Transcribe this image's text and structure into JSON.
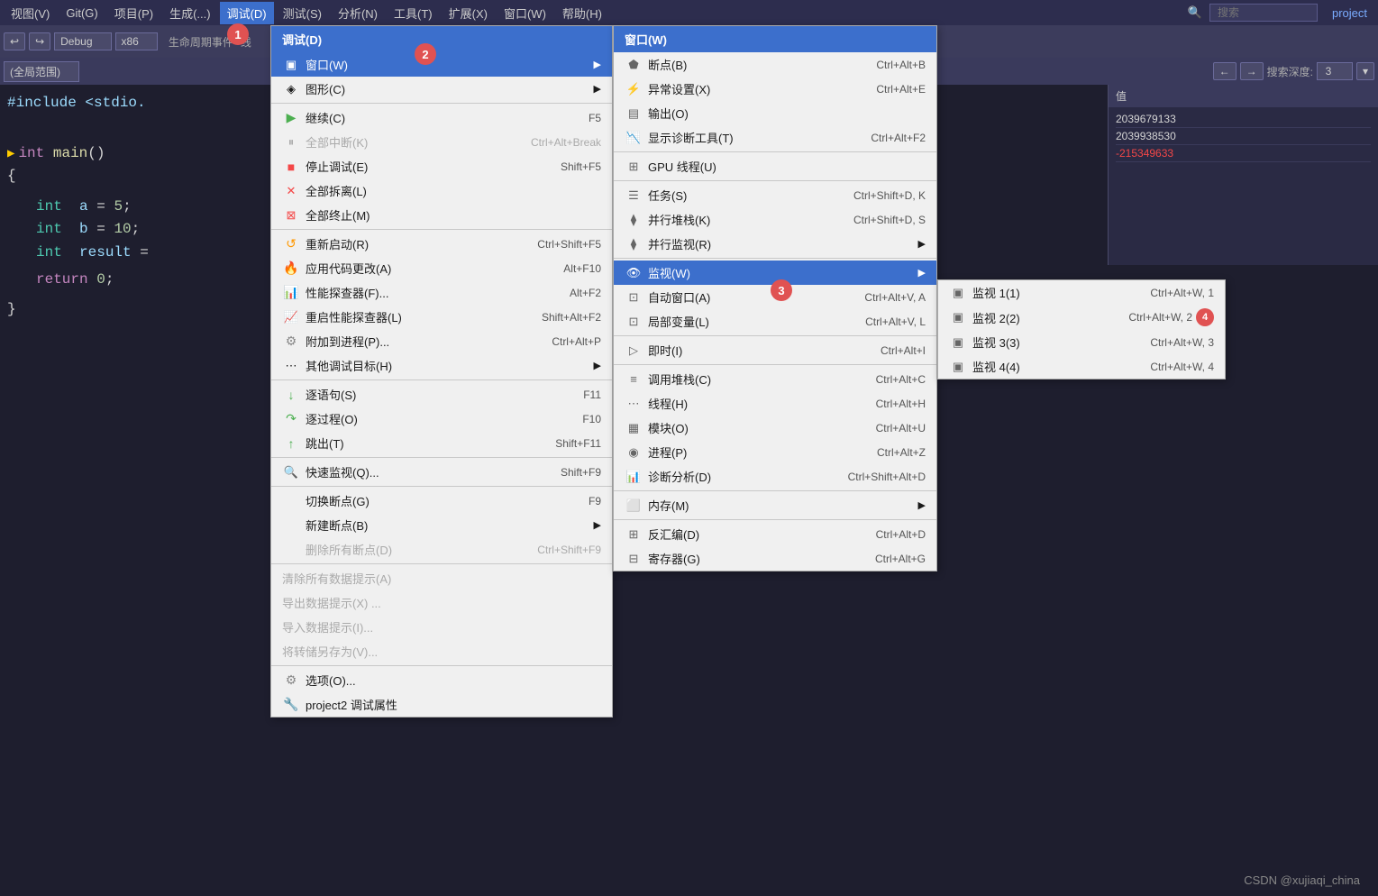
{
  "menubar": {
    "items": [
      {
        "label": "视图(V)",
        "active": false
      },
      {
        "label": "Git(G)",
        "active": false
      },
      {
        "label": "项目(P)",
        "active": false
      },
      {
        "label": "生成(...)",
        "active": false
      },
      {
        "label": "调试(D)",
        "active": true
      },
      {
        "label": "测试(S)",
        "active": false
      },
      {
        "label": "分析(N)",
        "active": false
      },
      {
        "label": "工具(T)",
        "active": false
      },
      {
        "label": "扩展(X)",
        "active": false
      },
      {
        "label": "窗口(W)",
        "active": false
      },
      {
        "label": "帮助(H)",
        "active": false
      }
    ],
    "search_placeholder": "搜索",
    "project_label": "project"
  },
  "toolbar": {
    "debug_config": "Debug",
    "platform": "x86",
    "lifecycle_label": "生命周期事件",
    "thread_label": "线"
  },
  "toolbar2": {
    "scope_label": "(全局范围)",
    "search_depth_label": "搜索深度:",
    "search_depth_value": "3"
  },
  "code": {
    "include_line": "#include <stdio.",
    "lines": [
      {
        "indent": 0,
        "text": "int main()",
        "has_indicator": true
      },
      {
        "indent": 0,
        "text": "{"
      },
      {
        "indent": 1,
        "text": "int  a = 5;"
      },
      {
        "indent": 1,
        "text": "int  b = 10;"
      },
      {
        "indent": 1,
        "text": "int  result "
      },
      {
        "indent": 1,
        "text": "return 0;"
      },
      {
        "indent": 0,
        "text": "}"
      }
    ]
  },
  "right_panel": {
    "header": "值",
    "nav_back": "←",
    "nav_forward": "→",
    "values": [
      {
        "text": "2039679133"
      },
      {
        "text": "2039938530"
      },
      {
        "text": "-215349633",
        "red": true
      }
    ]
  },
  "debug_menu": {
    "header": "调试(D)",
    "items": [
      {
        "label": "窗口(W)",
        "shortcut": "",
        "has_submenu": true,
        "highlighted": true,
        "icon": "window-icon"
      },
      {
        "label": "图形(C)",
        "shortcut": "",
        "has_submenu": true,
        "icon": "graphics-icon"
      },
      {
        "separator": true
      },
      {
        "label": "继续(C)",
        "shortcut": "F5",
        "icon": "play-icon"
      },
      {
        "label": "全部中断(K)",
        "shortcut": "Ctrl+Alt+Break",
        "icon": "pause-icon",
        "disabled": true
      },
      {
        "label": "停止调试(E)",
        "shortcut": "Shift+F5",
        "icon": "stop-icon"
      },
      {
        "label": "全部拆离(L)",
        "shortcut": "",
        "icon": "detach-icon"
      },
      {
        "label": "全部终止(M)",
        "shortcut": "",
        "icon": "terminate-icon"
      },
      {
        "separator": true
      },
      {
        "label": "重新启动(R)",
        "shortcut": "Ctrl+Shift+F5",
        "icon": "restart-icon"
      },
      {
        "label": "应用代码更改(A)",
        "shortcut": "Alt+F10",
        "icon": "hotreload-icon"
      },
      {
        "label": "性能探查器(F)...",
        "shortcut": "Alt+F2",
        "icon": "perf-icon"
      },
      {
        "label": "重启性能探查器(L)",
        "shortcut": "Shift+Alt+F2",
        "icon": "perf-restart-icon"
      },
      {
        "label": "附加到进程(P)...",
        "shortcut": "Ctrl+Alt+P",
        "icon": "attach-icon"
      },
      {
        "label": "其他调试目标(H)",
        "shortcut": "",
        "has_submenu": true,
        "icon": "other-icon"
      },
      {
        "separator": true
      },
      {
        "label": "逐语句(S)",
        "shortcut": "F11",
        "icon": "stepinto-icon"
      },
      {
        "label": "逐过程(O)",
        "shortcut": "F10",
        "icon": "stepover-icon"
      },
      {
        "label": "跳出(T)",
        "shortcut": "Shift+F11",
        "icon": "stepout-icon"
      },
      {
        "separator": true
      },
      {
        "label": "快速监视(Q)...",
        "shortcut": "Shift+F9",
        "icon": "quickwatch-icon"
      },
      {
        "separator": true
      },
      {
        "label": "切换断点(G)",
        "shortcut": "F9",
        "icon": ""
      },
      {
        "label": "新建断点(B)",
        "shortcut": "",
        "has_submenu": true,
        "icon": ""
      },
      {
        "label": "删除所有断点(D)",
        "shortcut": "Ctrl+Shift+F9",
        "icon": "",
        "disabled": true
      },
      {
        "separator": true
      },
      {
        "label": "清除所有数据提示(A)",
        "shortcut": "",
        "icon": "",
        "disabled": true
      },
      {
        "label": "导出数据提示(X) ...",
        "shortcut": "",
        "icon": "",
        "disabled": true
      },
      {
        "label": "导入数据提示(I)...",
        "shortcut": "",
        "icon": "",
        "disabled": true
      },
      {
        "label": "将转储另存为(V)...",
        "shortcut": "",
        "icon": "",
        "disabled": true
      },
      {
        "separator": true
      },
      {
        "label": "选项(O)...",
        "shortcut": "",
        "icon": "options-icon"
      },
      {
        "label": "project2 调试属性",
        "shortcut": "",
        "icon": "proj-icon"
      }
    ]
  },
  "window_menu": {
    "header": "窗口(W)",
    "items": [
      {
        "label": "断点(B)",
        "shortcut": "Ctrl+Alt+B",
        "icon": "breakpoint-icon"
      },
      {
        "label": "异常设置(X)",
        "shortcut": "Ctrl+Alt+E",
        "icon": "exception-icon"
      },
      {
        "label": "输出(O)",
        "shortcut": "",
        "icon": "output-icon"
      },
      {
        "label": "显示诊断工具(T)",
        "shortcut": "Ctrl+Alt+F2",
        "icon": "diag-icon"
      },
      {
        "separator": true
      },
      {
        "label": "GPU 线程(U)",
        "shortcut": "",
        "icon": "gpu-icon"
      },
      {
        "separator": true
      },
      {
        "label": "任务(S)",
        "shortcut": "Ctrl+Shift+D, K",
        "icon": "task-icon"
      },
      {
        "label": "并行堆栈(K)",
        "shortcut": "Ctrl+Shift+D, S",
        "icon": "parallel-stack-icon"
      },
      {
        "label": "并行监视(R)",
        "shortcut": "",
        "has_submenu": true,
        "icon": "parallel-watch-icon"
      },
      {
        "separator": true
      },
      {
        "label": "监视(W)",
        "shortcut": "",
        "has_submenu": true,
        "highlighted": true,
        "icon": "watch-icon"
      },
      {
        "label": "自动窗口(A)",
        "shortcut": "Ctrl+Alt+V, A",
        "icon": "auto-icon"
      },
      {
        "label": "局部变量(L)",
        "shortcut": "Ctrl+Alt+V, L",
        "icon": "locals-icon"
      },
      {
        "separator": true
      },
      {
        "label": "即时(I)",
        "shortcut": "Ctrl+Alt+I",
        "icon": "immediate-icon"
      },
      {
        "separator": true
      },
      {
        "label": "调用堆栈(C)",
        "shortcut": "Ctrl+Alt+C",
        "icon": "callstack-icon"
      },
      {
        "label": "线程(H)",
        "shortcut": "Ctrl+Alt+H",
        "icon": "threads-icon"
      },
      {
        "label": "模块(O)",
        "shortcut": "Ctrl+Alt+U",
        "icon": "modules-icon"
      },
      {
        "label": "进程(P)",
        "shortcut": "Ctrl+Alt+Z",
        "icon": "process-icon"
      },
      {
        "label": "诊断分析(D)",
        "shortcut": "Ctrl+Shift+Alt+D",
        "icon": "diag2-icon"
      },
      {
        "separator": true
      },
      {
        "label": "内存(M)",
        "shortcut": "",
        "has_submenu": true,
        "icon": "memory-icon"
      },
      {
        "separator": true
      },
      {
        "label": "反汇编(D)",
        "shortcut": "Ctrl+Alt+D",
        "icon": "disassembly-icon"
      },
      {
        "label": "寄存器(G)",
        "shortcut": "Ctrl+Alt+G",
        "icon": "registers-icon"
      }
    ]
  },
  "watch_menu": {
    "header": "监视(W)",
    "items": [
      {
        "label": "监视 1(1)",
        "shortcut": "Ctrl+Alt+W, 1",
        "icon": "watch1-icon"
      },
      {
        "label": "监视 2(2)",
        "shortcut": "Ctrl+Alt+W, 2",
        "icon": "watch2-icon",
        "has_badge": true
      },
      {
        "label": "监视 3(3)",
        "shortcut": "Ctrl+Alt+W, 3",
        "icon": "watch3-icon"
      },
      {
        "label": "监视 4(4)",
        "shortcut": "Ctrl+Alt+W, 4",
        "icon": "watch4-icon"
      }
    ]
  },
  "badges": [
    {
      "number": "1",
      "description": "debug menu badge"
    },
    {
      "number": "2",
      "description": "window submenu badge"
    },
    {
      "number": "3",
      "description": "watch submenu badge"
    },
    {
      "number": "4",
      "description": "watch 2 badge"
    }
  ],
  "watermark": "CSDN @xujiaqi_china"
}
